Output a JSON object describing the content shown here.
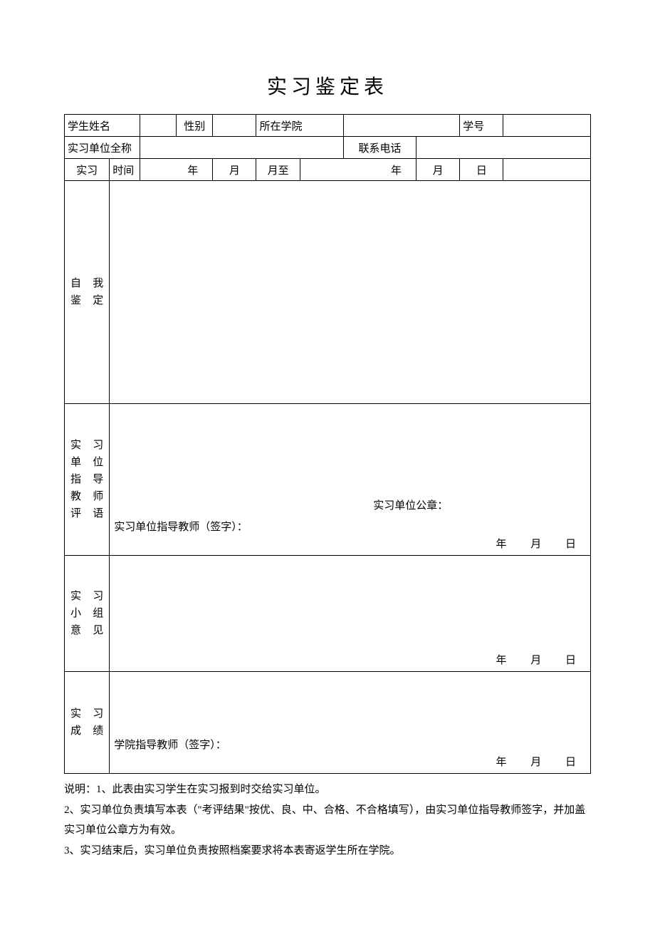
{
  "title": "实习鉴定表",
  "row1": {
    "name_label": "学生姓名",
    "gender_label": "性别",
    "college_label": "所在学院",
    "id_label": "学号"
  },
  "row2": {
    "unit_label": "实习单位全称",
    "phone_label": "联系电话"
  },
  "row3": {
    "period_label_a": "实习",
    "period_label_b": "时间",
    "y1": "年",
    "m1": "月",
    "to": "月至",
    "y2": "年",
    "m2": "月",
    "d2": "日"
  },
  "self_label": "自　我鉴定",
  "unit_teacher_label": "实　习单　位指　导教　师评语",
  "unit_teacher_sig": "实习单位指导教师（签字）：",
  "unit_seal": "实习单位公章：",
  "group_label": "实　习小　组意见",
  "grade_label": "实　习成绩",
  "college_teacher_sig": "学院指导教师（签字）：",
  "date_y": "年",
  "date_m": "月",
  "date_d": "日",
  "notes": {
    "prefix": "说明：",
    "n1": "1、此表由实习学生在实习报到时交给实习单位。",
    "n2": "2、实习单位负责填写本表（\"考评结果\"按优、良、中、合格、不合格填写），由实习单位指导教师签字，并加盖实习单位公章方为有效。",
    "n3": "3、实习结束后，实习单位负责按照档案要求将本表寄返学生所在学院。"
  }
}
